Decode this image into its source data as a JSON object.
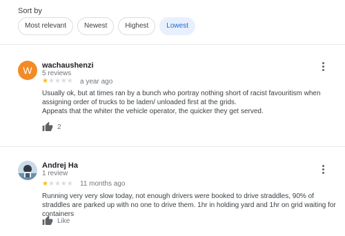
{
  "sort": {
    "label": "Sort by",
    "options": [
      "Most relevant",
      "Newest",
      "Highest",
      "Lowest"
    ],
    "selected": "Lowest"
  },
  "reviews": [
    {
      "avatar_letter": "W",
      "avatar_color": "#f28b26",
      "name": "wachaushenzi",
      "review_count": "5 reviews",
      "rating": 1,
      "max_rating": 5,
      "date": "a year ago",
      "text_lines": [
        "Usually ok, but at times ran by  a bunch who portray nothing short of racist favouritism when assigning order of trucks to be laden/ unloaded first at the grids.",
        "Appeats that the whiter the vehicle operator, the quicker they get served."
      ],
      "likes": "2",
      "like_icon": "thumbs-up-icon"
    },
    {
      "avatar_icon": "profile-photo",
      "name": "Andrej Ha",
      "review_count": "1 review",
      "rating": 1,
      "max_rating": 5,
      "date": "11 months ago",
      "text_lines": [
        "Running very very slow today, not enough drivers were booked to drive straddles, 90% of straddles are parked up with no one to drive them. 1hr in holding yard and 1hr on grid waiting for containers"
      ],
      "likes": "Like",
      "like_icon": "thumbs-up-icon"
    }
  ],
  "colors": {
    "star_on": "#fbbc04",
    "star_off": "#dadce0",
    "chip_active_bg": "#e8f0fe",
    "chip_active_text": "#1967d2"
  }
}
